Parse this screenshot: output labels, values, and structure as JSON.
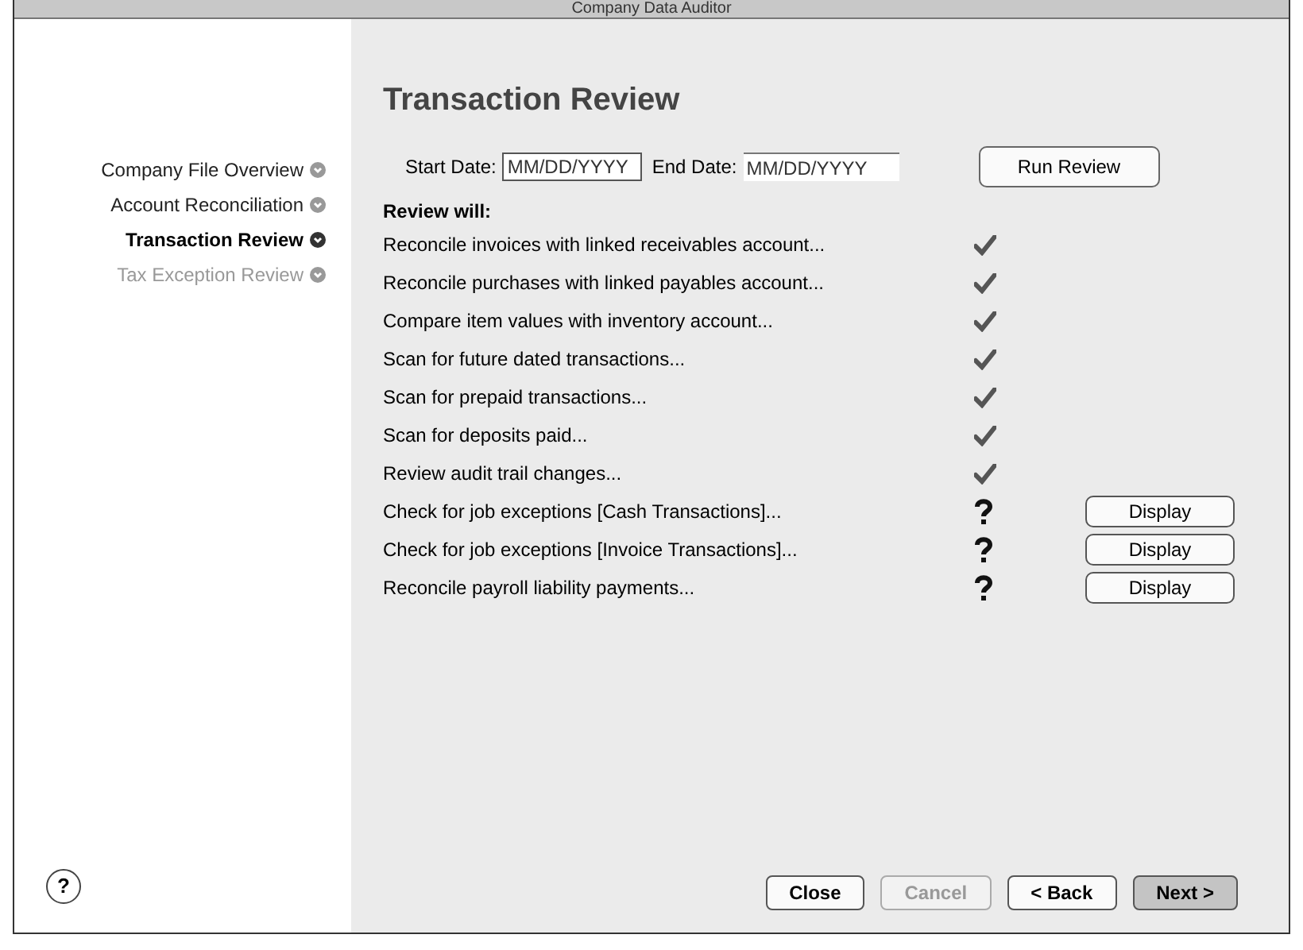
{
  "window": {
    "title": "Company Data Auditor"
  },
  "sidebar": {
    "items": [
      {
        "label": "Company File Overview",
        "selected": false,
        "disabled": false
      },
      {
        "label": "Account Reconciliation",
        "selected": false,
        "disabled": false
      },
      {
        "label": "Transaction Review",
        "selected": true,
        "disabled": false
      },
      {
        "label": "Tax Exception Review",
        "selected": false,
        "disabled": true
      }
    ]
  },
  "heading": "Transaction Review",
  "start_date": {
    "label": "Start Date:",
    "placeholder": "MM/DD/YYYY"
  },
  "end_date": {
    "label": "End Date:",
    "placeholder": "MM/DD/YYYY"
  },
  "run_button": "Run Review",
  "review_heading": "Review will:",
  "checks": [
    {
      "label": "Reconcile invoices with linked receivables account...",
      "kind": "check"
    },
    {
      "label": "Reconcile purchases with linked payables account...",
      "kind": "check"
    },
    {
      "label": "Compare item values with inventory account...",
      "kind": "check"
    },
    {
      "label": "Scan for future dated transactions...",
      "kind": "check"
    },
    {
      "label": "Scan for prepaid transactions...",
      "kind": "check"
    },
    {
      "label": "Scan for deposits paid...",
      "kind": "check"
    },
    {
      "label": "Review audit trail changes...",
      "kind": "check"
    },
    {
      "label": "Check for job exceptions [Cash Transactions]...",
      "kind": "question",
      "button": "Display"
    },
    {
      "label": "Check for job exceptions [Invoice Transactions]...",
      "kind": "question",
      "button": "Display"
    },
    {
      "label": "Reconcile payroll liability payments...",
      "kind": "question",
      "button": "Display"
    }
  ],
  "help_button": "?",
  "footer_buttons": [
    {
      "label": "Close",
      "disabled": false,
      "default": false
    },
    {
      "label": "Cancel",
      "disabled": true,
      "default": false
    },
    {
      "label": "< Back",
      "disabled": false,
      "default": false
    },
    {
      "label": "Next >",
      "disabled": false,
      "default": true
    }
  ]
}
